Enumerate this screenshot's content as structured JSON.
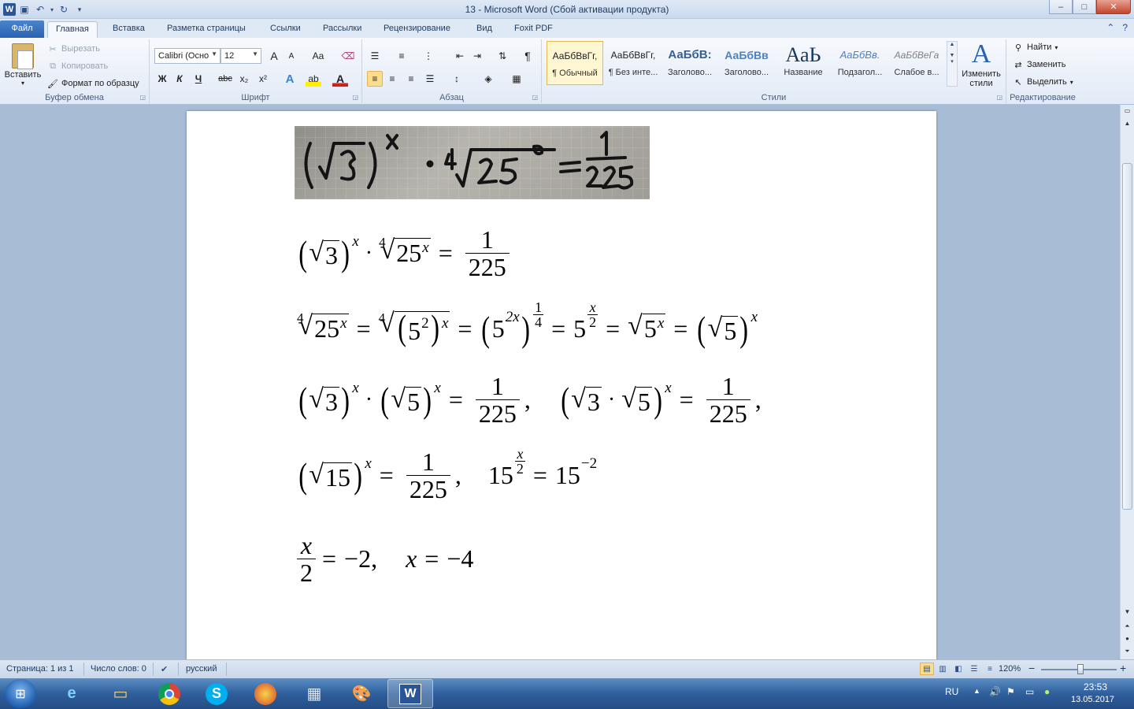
{
  "window": {
    "title": "13 - Microsoft Word (Сбой активации продукта)",
    "minimize": "–",
    "maximize": "□",
    "close": "✕"
  },
  "tabs": [
    {
      "label": "Файл"
    },
    {
      "label": "Главная"
    },
    {
      "label": "Вставка"
    },
    {
      "label": "Разметка страницы"
    },
    {
      "label": "Ссылки"
    },
    {
      "label": "Рассылки"
    },
    {
      "label": "Рецензирование"
    },
    {
      "label": "Вид"
    },
    {
      "label": "Foxit PDF"
    }
  ],
  "clipboard": {
    "paste": "Вставить",
    "cut": "Вырезать",
    "copy": "Копировать",
    "format_painter": "Формат по образцу",
    "group": "Буфер обмена"
  },
  "font": {
    "name": "Calibri (Осно",
    "size": "12",
    "group": "Шрифт",
    "grow": "A",
    "shrink": "A",
    "case": "Aa",
    "bold": "Ж",
    "italic": "К",
    "underline": "Ч",
    "strike": "abc",
    "sub": "x₂",
    "super": "x²",
    "effects": "A",
    "highlight": "ab",
    "color": "A"
  },
  "paragraph": {
    "group": "Абзац",
    "pilcrow": "¶"
  },
  "styles": {
    "group": "Стили",
    "items": [
      {
        "preview": "АаБбВвГг,",
        "name": "¶ Обычный"
      },
      {
        "preview": "АаБбВвГг,",
        "name": "¶ Без инте..."
      },
      {
        "preview": "АаБбВ:",
        "name": "Заголово..."
      },
      {
        "preview": "АаБбВв",
        "name": "Заголово..."
      },
      {
        "preview": "АаЬ",
        "name": "Название"
      },
      {
        "preview": "АаБбВв.",
        "name": "Подзагол..."
      },
      {
        "preview": "АаБбВеГа",
        "name": "Слабое в..."
      }
    ],
    "change": "Изменить стили",
    "change_icon": "A"
  },
  "editing": {
    "group": "Редактирование",
    "find": "Найти",
    "replace": "Заменить",
    "select": "Выделить"
  },
  "document": {
    "photo_text": "(√3)ˣ · ⁴√25ˣ = 1/225",
    "eq1": {
      "base": "3",
      "sup_x": "x",
      "idx": "4",
      "radicand": "25",
      "eq": "=",
      "num": "1",
      "den": "225"
    },
    "eq2": {
      "idx": "4",
      "radicand": "25",
      "sup_x": "x",
      "five": "5",
      "two": "2",
      "twox": "2x",
      "quarter_num": "1",
      "quarter_den": "4",
      "half_num": "x",
      "half_den": "2",
      "eq": "="
    },
    "eq3": {
      "three": "3",
      "five": "5",
      "sup_x": "x",
      "num": "1",
      "den": "225",
      "comma": ","
    },
    "eq4": {
      "fifteen": "15",
      "sup_x": "x",
      "num": "1",
      "den": "225",
      "comma": ",",
      "neg2": "−2",
      "half_num": "x",
      "half_den": "2"
    },
    "eq5": {
      "num": "x",
      "den": "2",
      "eq": "=",
      "m2": "−2,",
      "x": "x",
      "m4": "−4"
    }
  },
  "status": {
    "page": "Страница: 1 из 1",
    "words": "Число слов: 0",
    "lang": "русский",
    "zoom": "120%",
    "zoom_minus": "−",
    "zoom_plus": "+"
  },
  "taskbar": {
    "lang": "RU",
    "time": "23:53",
    "date": "13.05.2017"
  }
}
